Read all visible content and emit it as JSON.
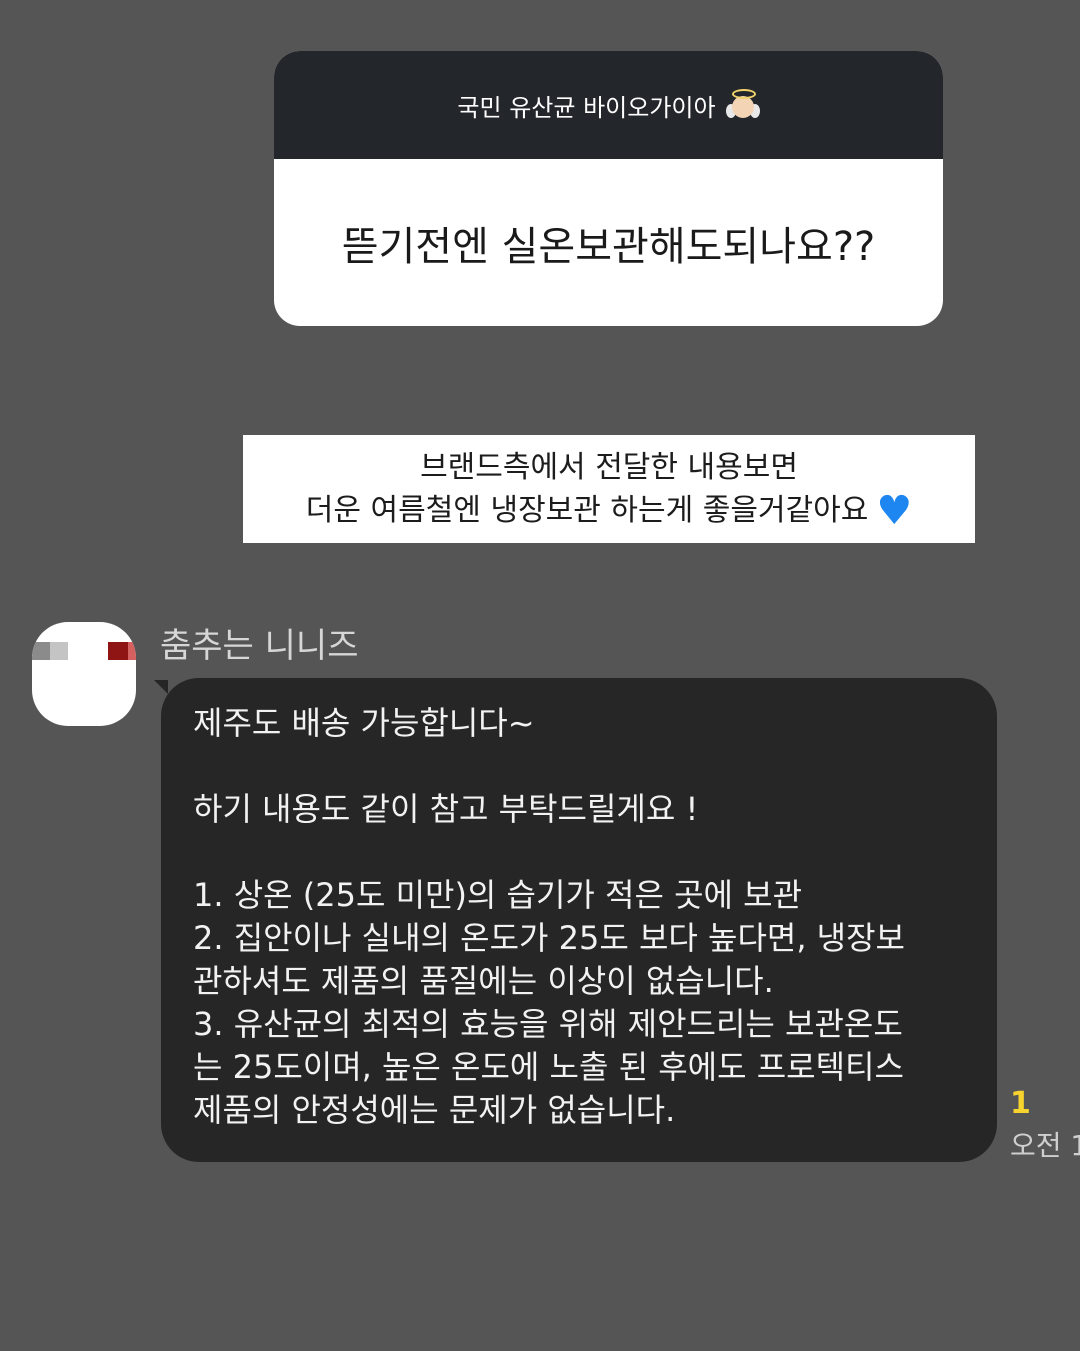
{
  "question_sticker": {
    "header": "국민 유산균 바이오가이아",
    "question": "뜯기전엔 실온보관해도되나요??"
  },
  "caption": {
    "line1": "브랜드측에서 전달한 내용보면",
    "line2": "더운 여름철엔 냉장보관 하는게 좋을거같아요"
  },
  "chat": {
    "sender_name": "춤추는 니니즈",
    "message_lines": [
      "제주도 배송 가능합니다~",
      "",
      "하기 내용도 같이 참고 부탁드릴게요 !",
      "",
      "1. 상온 (25도 미만)의 습기가 적은 곳에 보관",
      "2. 집안이나 실내의 온도가 25도 보다 높다면, 냉장보",
      "관하셔도 제품의 품질에는 이상이 없습니다.",
      "3. 유산균의 최적의 효능을 위해 제안드리는 보관온도",
      "는 25도이며, 높은 온도에 노출 된 후에도 프로텍티스",
      "제품의 안정성에는 문제가 없습니다."
    ],
    "unread_count": "1",
    "time": "오전 1"
  },
  "icons": {
    "header_emoji": "angel-emoji-icon",
    "caption_emoji": "blue-heart-icon"
  },
  "colors": {
    "background": "#555556",
    "header_dark": "#23262b",
    "bubble": "#262626",
    "unread_yellow": "#f6d32d",
    "heart_blue": "#1d86f0"
  }
}
